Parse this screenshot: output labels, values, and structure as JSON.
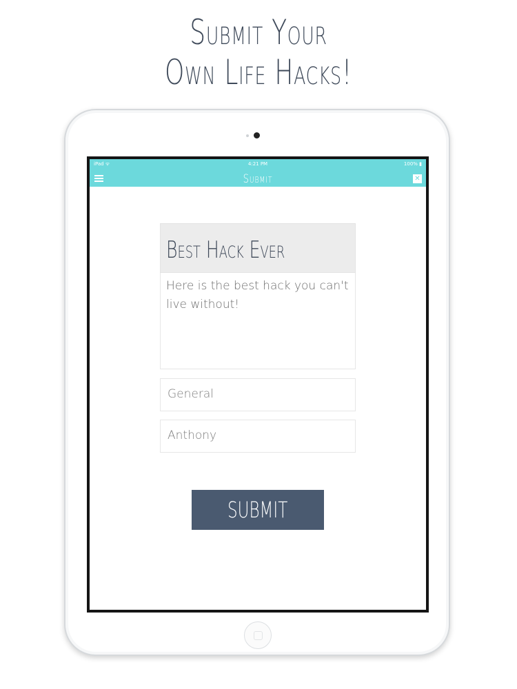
{
  "promo": {
    "headline_line1": "Submit Your",
    "headline_line2": "Own Life Hacks!"
  },
  "status_bar": {
    "carrier": "iPad ᯤ",
    "time": "4:21 PM",
    "battery": "100% ▮"
  },
  "navbar": {
    "title": "Submit",
    "menu_icon": "hamburger-icon",
    "close_icon": "close-icon",
    "close_glyph": "✕"
  },
  "form": {
    "title_value": "Best Hack Ever",
    "body_value": "Here is the best hack you can't live without!",
    "category_value": "General",
    "author_value": "Anthony"
  },
  "actions": {
    "submit_label": "SUBMIT"
  },
  "colors": {
    "accent": "#6cd9dc",
    "button": "#4a5a70",
    "text_dark": "#3f4a5a"
  }
}
